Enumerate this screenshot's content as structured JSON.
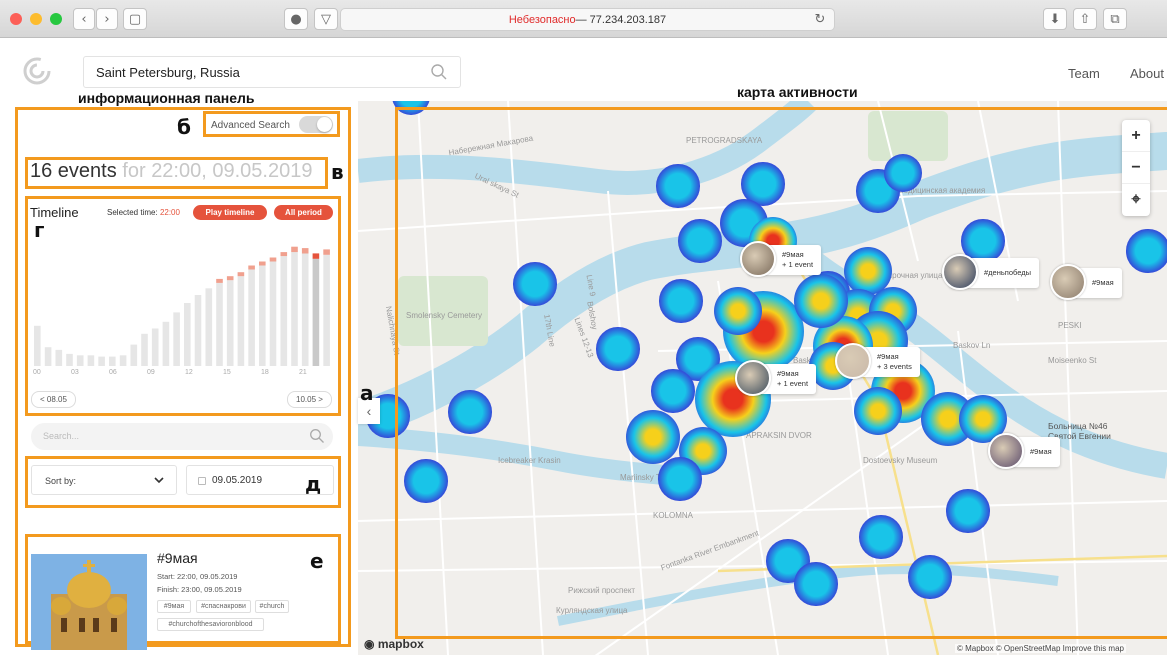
{
  "browser": {
    "address_warning": "Небезопасно",
    "address_host": " — 77.234.203.187"
  },
  "header": {
    "city": "Saint Petersburg, Russia",
    "nav": [
      "Team",
      "About"
    ]
  },
  "annotations": {
    "panel_title": "информационная панель",
    "map_title": "карта активности",
    "a": "а",
    "b": "б",
    "v": "в",
    "g": "г",
    "d": "д",
    "e": "е"
  },
  "panel": {
    "advanced_search": "Advanced Search",
    "advanced_on": false,
    "events_count": "16 events",
    "events_time": " for 22:00, 09.05.2019",
    "timeline": {
      "title": "Timeline",
      "selected_label": "Selected time:",
      "selected_value": "22:00",
      "play": "Play timeline",
      "all": "All period",
      "hour_labels": [
        "00",
        "03",
        "06",
        "09",
        "12",
        "15",
        "18",
        "21"
      ],
      "prev": "< 08.05",
      "next": "10.05 >"
    },
    "search_placeholder": "Search...",
    "sort_label": "Sort by:",
    "date_value": "09.05.2019",
    "card": {
      "tag": "#9мая",
      "start": "Start: 22:00, 09.05.2019",
      "finish": "Finish: 23:00, 09.05.2019",
      "chips": [
        "#9мая",
        "#спаснакрови",
        "#church",
        "#churchofthesavioronblood"
      ]
    }
  },
  "chart_data": {
    "type": "bar",
    "title": "Timeline",
    "x_labels": [
      "00",
      "03",
      "06",
      "09",
      "12",
      "15",
      "18",
      "21"
    ],
    "values": [
      30,
      14,
      12,
      9,
      8,
      8,
      7,
      7,
      8,
      16,
      24,
      28,
      33,
      40,
      47,
      53,
      58,
      62,
      64,
      67,
      72,
      75,
      78,
      82,
      85,
      84,
      80,
      83
    ],
    "highlight_values": [
      3,
      3,
      3,
      3,
      3,
      3,
      3,
      4,
      4,
      4,
      4
    ],
    "selected_index": 26,
    "ylim": [
      0,
      100
    ]
  },
  "map": {
    "labels": [
      "PETROGRADSKAYA",
      "Набережная Макарова",
      "Ural skaya St",
      "Smolensky Cemetery",
      "Nalichnaya St",
      "Icebreaker Krasin",
      "KOLOMNA",
      "APRAKSIN DVOR",
      "Dostoevsky Museum",
      "Moiseenko St",
      "PESKI",
      "Baskov Ln",
      "Кирочная улица",
      "Больница №46 Святой Евгении",
      "Рижский проспект",
      "Курляндская улица",
      "Fontanka River Embankment",
      "Военно-медицинская академия",
      "17th Line",
      "Line 9",
      "Lines 12-13",
      "Bolshoy",
      "Baskov",
      "Mariinsky Theatre"
    ],
    "popups": [
      {
        "tag": "#9мая",
        "extra": "+ 1 event"
      },
      {
        "tag": "#деньпобеды",
        "extra": ""
      },
      {
        "tag": "#9мая",
        "extra": ""
      },
      {
        "tag": "#9мая",
        "extra": "+ 3 events"
      },
      {
        "tag": "#9мая",
        "extra": "+ 1 event"
      },
      {
        "tag": "#9мая",
        "extra": ""
      }
    ],
    "zoom_in": "+",
    "zoom_out": "−",
    "locate": "⌖",
    "logo": "mapbox",
    "attribution": "© Mapbox © OpenStreetMap Improve this map",
    "colors": {
      "hot": "#e8321e",
      "warm": "#f6d01b",
      "cool": "#19c4e8",
      "cold": "#3546d8"
    }
  }
}
